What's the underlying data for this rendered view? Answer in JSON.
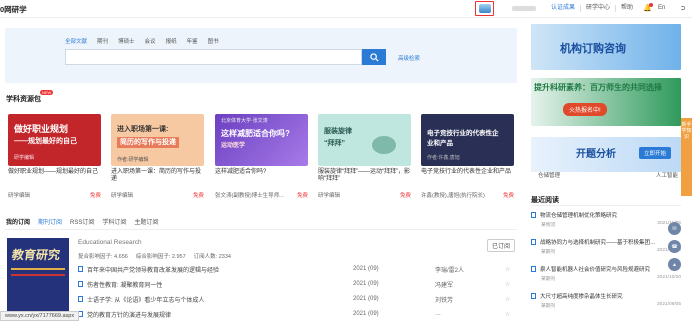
{
  "header": {
    "brand": "0网研学",
    "links": [
      "认证成果",
      "研学中心",
      "帮助"
    ],
    "lang": "En"
  },
  "search": {
    "tabs": [
      "全部文献",
      "期刊",
      "博硕士",
      "会议",
      "报纸",
      "年鉴",
      "图书"
    ],
    "advanced": "高级检索"
  },
  "resources": {
    "title": "学科资源包",
    "badge": "NEW",
    "cards": [
      {
        "cover_line1": "做好职业规划",
        "cover_line2": "——规划最好的自己",
        "cover_tag": "研学编辑",
        "title": "做好职业规划——规划最好的自己",
        "editor": "研学编辑",
        "price": "免费",
        "bg": "#c3262a"
      },
      {
        "cover_line1": "进入职场第一课:",
        "cover_line2": "简历的写作与投递",
        "cover_tag": "作者:研学编辑",
        "title": "进入职场第一课：简历的写作与投递",
        "editor": "研学编辑",
        "price": "免费",
        "bg": "#f7c9a3"
      },
      {
        "cover_line1": "这样减肥适合你吗?",
        "cover_line2": "运动医学",
        "cover_tag": "北京体育大学·张文涛",
        "title": "这样减肥适合你吗?",
        "editor": "张文涛(副教授)博士生导师...",
        "price": "免费",
        "bg": "#7b4fc9"
      },
      {
        "cover_line1": "服装旋律",
        "cover_line2": "“拜拜”",
        "cover_tag": "",
        "title": "服装旋律“拜拜”——运动“拜拜”，影响“拜拜”",
        "editor": "研学编辑",
        "price": "免费",
        "bg": "#bfe6df"
      },
      {
        "cover_line1": "电子竞技行业的代表性企",
        "cover_line2": "业和产品",
        "cover_tag": "作者:许鑫,唐旭",
        "title": "电子竞技行业的代表性企业和产品",
        "editor": "许鑫(教授),唐旭(执行院长)",
        "price": "免费",
        "bg": "#2a2f55"
      }
    ]
  },
  "subscriptions": {
    "tabs": [
      "我的订阅",
      "期刊订阅",
      "RSS订阅",
      "学科订阅",
      "主题订阅"
    ],
    "journal": {
      "cover_title": "教育研究",
      "name": "Educational Research",
      "stats": [
        "复合影响因子: 4.656",
        "综合影响因子: 2.957",
        "订阅人数: 2334"
      ],
      "status": "已订阅"
    },
    "articles": [
      {
        "title": "百年来中国共产党领导教育改革发展的逻辑与经验",
        "year": "2021 (09)",
        "author": "李瑞/雷2人"
      },
      {
        "title": "伤者性教育: 凝聚教育同一性",
        "year": "2021 (09)",
        "author": "冯建军"
      },
      {
        "title": "士语子学: 从《论语》看少年立志与个体成人",
        "year": "2021 (09)",
        "author": "刘铁芳"
      },
      {
        "title": "党的教育方针的演进与发展规律",
        "year": "2021 (09)",
        "author": "…"
      }
    ]
  },
  "sidebar": {
    "banner1": "机构订购咨询",
    "banner2": "提升科研素养：百万师生的共同选择",
    "banner2_btn": "火热报名中!",
    "banner3": "开题分析",
    "banner3_btn": "立即开始",
    "banner3_labels": [
      "仓储管理",
      "人工智能"
    ],
    "side_flag": "新手学知识",
    "recent_title": "最近阅读",
    "recent": [
      {
        "title": "物流仓储管理机制优化策略研究",
        "src": "某物流",
        "date": "2021/11/05"
      },
      {
        "title": "战略协同力与选择机制研究——基于积极集团…",
        "src": "某期刊",
        "date": "2021/10/29"
      },
      {
        "title": "泉人智能机器人社会价值研究与风险规避研究",
        "src": "某期刊",
        "date": "2021/10/20"
      },
      {
        "title": "大尺寸超高纯度掺杂晶体生长研究",
        "src": "某期刊",
        "date": "2021/09/05"
      }
    ]
  },
  "status_bar": {
    "url": "www.yx.cn/yx/7177669.aspx"
  }
}
